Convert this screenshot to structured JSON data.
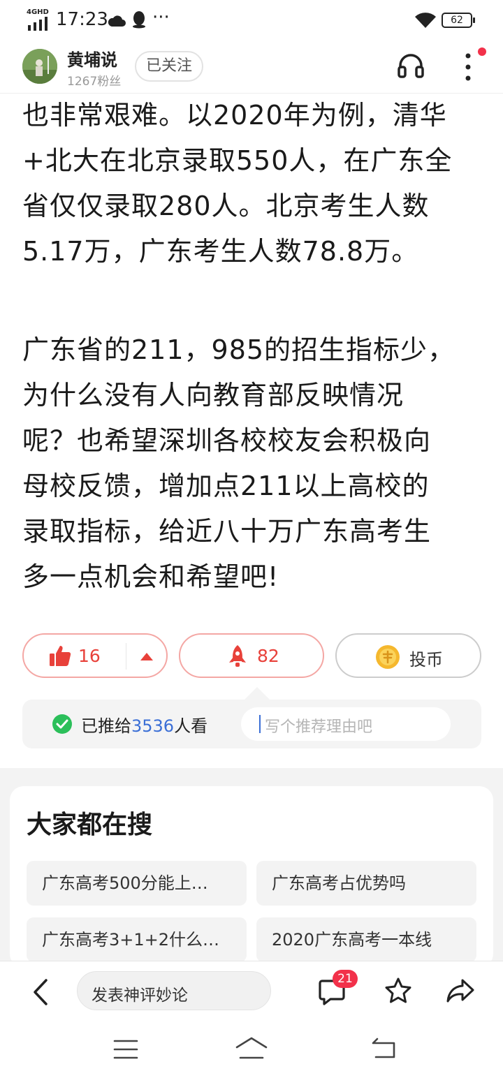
{
  "status_bar": {
    "network": "4GHD",
    "time": "17:23",
    "more": "···",
    "battery": "62"
  },
  "header": {
    "author_name": "黄埔说",
    "followers": "1267粉丝",
    "follow_label": "已关注"
  },
  "article": {
    "paragraph1_lines": [
      "也非常艰难。以2020年为例，清华",
      "+北大在北京录取550人，在广东全",
      "省仅仅录取280人。北京考生人数",
      "5.17万，广东考生人数78.8万。"
    ],
    "paragraph2_lines": [
      "广东省的211，985的招生指标少，",
      "为什么没有人向教育部反映情况",
      "呢？也希望深圳各校校友会积极向",
      "母校反馈，增加点211以上高校的",
      "录取指标，给近八十万广东高考生",
      "多一点机会和希望吧!"
    ]
  },
  "actions": {
    "like_count": "16",
    "recommend_count": "82",
    "coin_label": "投币"
  },
  "recommend": {
    "prefix": "已推给",
    "count": "3536",
    "suffix": "人看",
    "input_placeholder": "写个推荐理由吧"
  },
  "search": {
    "title": "大家都在搜",
    "chips": [
      "广东高考500分能上…",
      "广东高考占优势吗",
      "广东高考3+1+2什么…",
      "2020广东高考一本线"
    ]
  },
  "bottom_bar": {
    "comment_placeholder": "发表神评妙论",
    "comment_badge": "21"
  },
  "colors": {
    "accent_red": "#e8413a",
    "link_blue": "#3b6fd6",
    "check_green": "#2bbf5a",
    "coin_gold": "#f5b82e"
  }
}
